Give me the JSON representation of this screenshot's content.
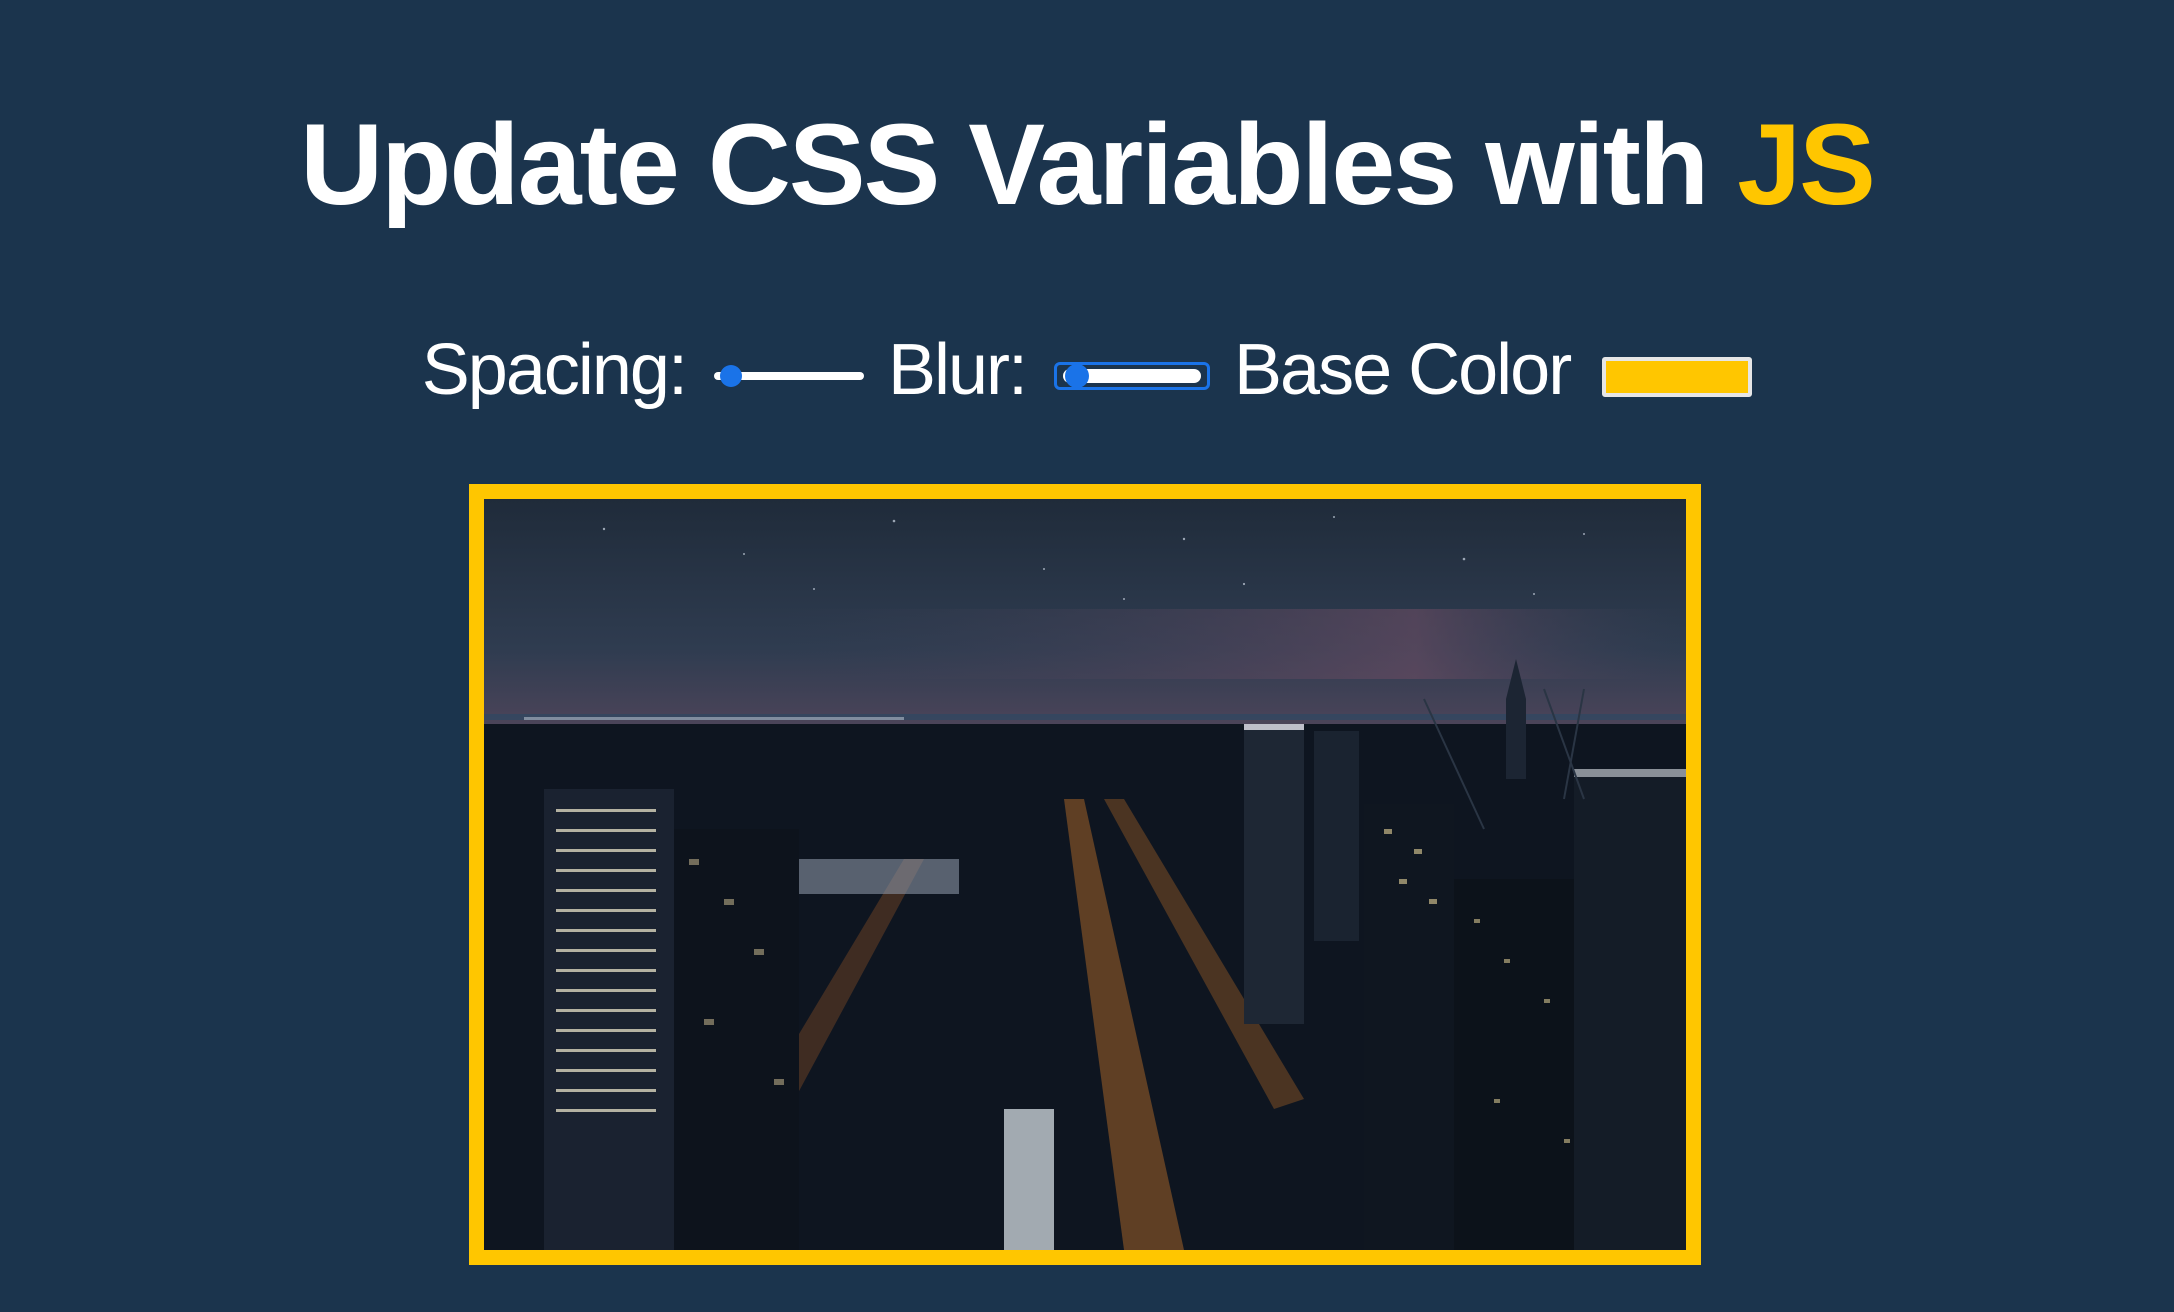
{
  "title": {
    "main": "Update CSS Variables with ",
    "highlight": "JS"
  },
  "controls": {
    "spacing_label": "Spacing:",
    "spacing_value": 0.05,
    "blur_label": "Blur:",
    "blur_value": 0.05,
    "base_color_label": "Base Color",
    "base_color_value": "#ffc600"
  },
  "colors": {
    "background": "#1b344d",
    "accent": "#ffc600",
    "slider_thumb": "#1a73e8"
  },
  "image": {
    "subject": "night city skyline aerial photo"
  }
}
